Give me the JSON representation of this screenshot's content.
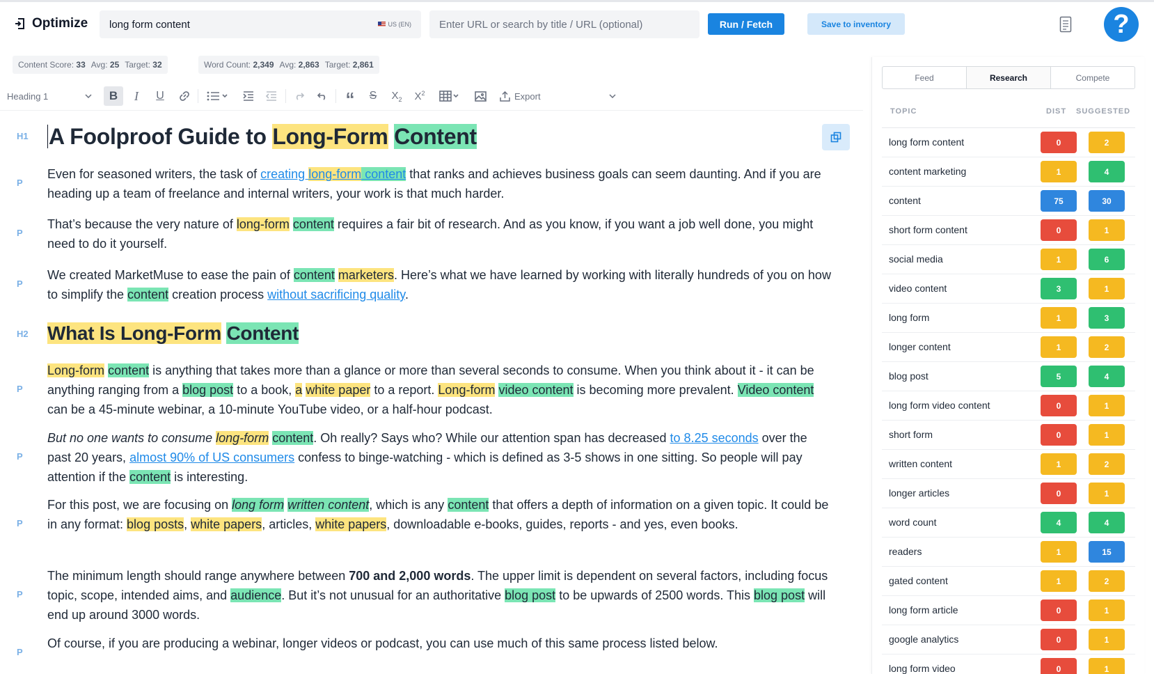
{
  "app": {
    "title": "Optimize"
  },
  "search": {
    "keyword": "long form content",
    "locale": "US (EN)",
    "url_placeholder": "Enter URL or search by title / URL (optional)"
  },
  "actions": {
    "run_label": "Run / Fetch",
    "save_label": "Save to inventory",
    "help_label": "?"
  },
  "scores": {
    "content_score_label": "Content Score:",
    "content_score": "33",
    "content_avg_label": "Avg:",
    "content_avg": "25",
    "content_target_label": "Target:",
    "content_target": "32",
    "word_count_label": "Word Count:",
    "word_count": "2,349",
    "word_avg_label": "Avg:",
    "word_avg": "2,863",
    "word_target_label": "Target:",
    "word_target": "2,861"
  },
  "toolbar": {
    "heading_select": "Heading 1",
    "export_label": "Export"
  },
  "editor": {
    "tags": [
      "H1",
      "P",
      "P",
      "P",
      "H2",
      "P",
      "P",
      "P",
      "P",
      "P"
    ],
    "h1": {
      "t1": "A Foolproof Guide to ",
      "h1": "Long-Form",
      "h2": "Content"
    },
    "p1": {
      "t1": "Even for seasoned writers, the task of ",
      "l1": "creating ",
      "l2": "long-form",
      "l3": " content",
      "t2": " that ranks and achieves business goals can seem daunting. And if you are heading up a team of freelance and internal writers, your work is that much harder."
    },
    "p2": {
      "t1": "That’s because the very nature of ",
      "h1": "long-form",
      "h2": "content",
      "t2": " requires a fair bit of research. And as you know, if you want a job well done, you might need to do it yourself."
    },
    "p3": {
      "t1": "We created MarketMuse to ease the pain of ",
      "h1": "content",
      "h2": "marketers",
      "t2": ". Here’s what we have learned by working with literally hundreds of you on how to simplify the ",
      "h3": "content",
      "t3": " creation process ",
      "l1": "without sacrificing quality",
      "t4": "."
    },
    "h2": {
      "h1": "What Is Long-Form",
      "h2": "Content"
    },
    "p4": {
      "h1": "Long-form",
      "h2": "content",
      "t1": " is anything that takes more than a glance or more than several seconds to consume. When you think about it - it can be anything ranging from a ",
      "h3": "blog post",
      "t2": " to a book, ",
      "h4": "a",
      "h5": "white paper",
      "t3": " to a report. ",
      "h6": "Long-form",
      "h7": "video content",
      "t4": " is becoming more prevalent. ",
      "h8": "Video content",
      "t5": " can be a 45-minute webinar, a 10-minute YouTube video, or a half-hour podcast."
    },
    "p5": {
      "i1": "But no one wants to consume ",
      "h1": "long-form",
      "h2": "content",
      "t1": ". Oh really? Says who? While our attention span has decreased ",
      "l1": "to 8.25 seconds",
      "t2": " over the past 20 years,  ",
      "l2": "almost 90% of US consumers",
      "t3": " confess to binge-watching - which is defined as 3-5 shows in one sitting. So people will pay attention if the ",
      "h3": "content",
      "t4": " is interesting."
    },
    "p6": {
      "t1": "For this post, we are focusing on ",
      "h1": "long form",
      "h2": "written content",
      "t2": ", which is any ",
      "h3": "content",
      "t3": " that offers a depth of information on a given topic. It could be in any format: ",
      "h4": "blog posts",
      "t4": ", ",
      "h5": "white papers",
      "t5": ", articles, ",
      "h6": "white papers",
      "t6": ", downloadable e-books, guides, reports - and yes, even books."
    },
    "p7": {
      "t1": "The minimum length should range anywhere between ",
      "b1": "700 and 2,000 words",
      "t2": ". The upper limit is dependent on several factors, including focus topic, scope, intended aims, and ",
      "h1": "audience",
      "t3": ". But it’s not unusual for an authoritative ",
      "h2": "blog post",
      "t4": " to be upwards of 2500 words. This ",
      "h3": "blog post",
      "t5": " will end up around 3000 words."
    },
    "p8": {
      "t1": "Of course, if you are producing a webinar, longer videos or podcast, you can use much of this same process listed below."
    }
  },
  "panel": {
    "tabs": [
      "Feed",
      "Research",
      "Compete"
    ],
    "active_tab": "Research",
    "headers": {
      "topic": "TOPIC",
      "dist": "DIST",
      "suggested": "SUGGESTED"
    },
    "colors": {
      "red": "#e74c3c",
      "yellow": "#f5b921",
      "green": "#2fbf71",
      "blue": "#2f86de"
    },
    "rows": [
      {
        "topic": "long form content",
        "dist": "0",
        "dist_color": "red",
        "suggested": "2",
        "suggested_color": "yellow"
      },
      {
        "topic": "content marketing",
        "dist": "1",
        "dist_color": "yellow",
        "suggested": "4",
        "suggested_color": "green"
      },
      {
        "topic": "content",
        "dist": "75",
        "dist_color": "blue",
        "suggested": "30",
        "suggested_color": "blue"
      },
      {
        "topic": "short form content",
        "dist": "0",
        "dist_color": "red",
        "suggested": "1",
        "suggested_color": "yellow"
      },
      {
        "topic": "social media",
        "dist": "1",
        "dist_color": "yellow",
        "suggested": "6",
        "suggested_color": "green"
      },
      {
        "topic": "video content",
        "dist": "3",
        "dist_color": "green",
        "suggested": "1",
        "suggested_color": "yellow"
      },
      {
        "topic": "long form",
        "dist": "1",
        "dist_color": "yellow",
        "suggested": "3",
        "suggested_color": "green"
      },
      {
        "topic": "longer content",
        "dist": "1",
        "dist_color": "yellow",
        "suggested": "2",
        "suggested_color": "yellow"
      },
      {
        "topic": "blog post",
        "dist": "5",
        "dist_color": "green",
        "suggested": "4",
        "suggested_color": "green"
      },
      {
        "topic": "long form video content",
        "dist": "0",
        "dist_color": "red",
        "suggested": "1",
        "suggested_color": "yellow"
      },
      {
        "topic": "short form",
        "dist": "0",
        "dist_color": "red",
        "suggested": "1",
        "suggested_color": "yellow"
      },
      {
        "topic": "written content",
        "dist": "1",
        "dist_color": "yellow",
        "suggested": "2",
        "suggested_color": "yellow"
      },
      {
        "topic": "longer articles",
        "dist": "0",
        "dist_color": "red",
        "suggested": "1",
        "suggested_color": "yellow"
      },
      {
        "topic": "word count",
        "dist": "4",
        "dist_color": "green",
        "suggested": "4",
        "suggested_color": "green"
      },
      {
        "topic": "readers",
        "dist": "1",
        "dist_color": "yellow",
        "suggested": "15",
        "suggested_color": "blue"
      },
      {
        "topic": "gated content",
        "dist": "1",
        "dist_color": "yellow",
        "suggested": "2",
        "suggested_color": "yellow"
      },
      {
        "topic": "long form article",
        "dist": "0",
        "dist_color": "red",
        "suggested": "1",
        "suggested_color": "yellow"
      },
      {
        "topic": "google analytics",
        "dist": "0",
        "dist_color": "red",
        "suggested": "1",
        "suggested_color": "yellow"
      },
      {
        "topic": "long form video",
        "dist": "0",
        "dist_color": "red",
        "suggested": "1",
        "suggested_color": "yellow"
      }
    ]
  }
}
